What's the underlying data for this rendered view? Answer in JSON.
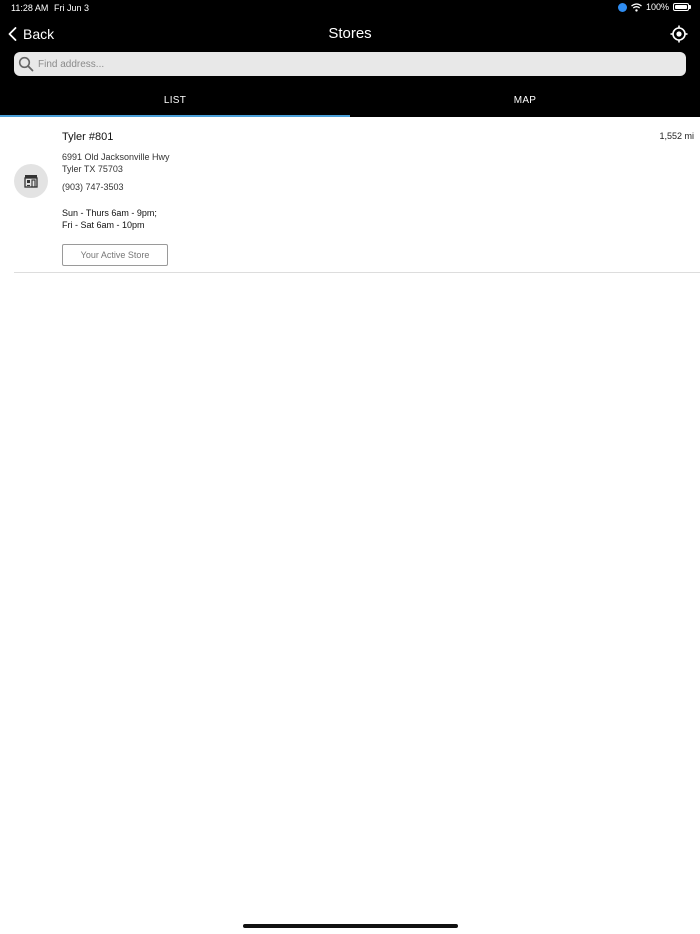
{
  "status_bar": {
    "time": "11:28 AM",
    "date": "Fri Jun 3",
    "battery": "100%"
  },
  "header": {
    "back_label": "Back",
    "title": "Stores"
  },
  "search": {
    "placeholder": "Find address..."
  },
  "tabs": [
    {
      "label": "LIST",
      "active": true
    },
    {
      "label": "MAP",
      "active": false
    }
  ],
  "stores": [
    {
      "name": "Tyler #801",
      "distance": "1,552 mi",
      "address_line1": "6991 Old Jacksonville Hwy",
      "address_line2": "Tyler TX 75703",
      "phone": "(903) 747-3503",
      "hours_line1": "Sun - Thurs 6am - 9pm;",
      "hours_line2": "Fri - Sat 6am - 10pm",
      "action_label": "Your Active Store",
      "icon": "store-icon"
    }
  ],
  "colors": {
    "header_bg": "#000000",
    "tab_indicator": "#4a9fd8",
    "search_bg": "#e8e8e8",
    "location_arrow": "#2f8cf0"
  }
}
